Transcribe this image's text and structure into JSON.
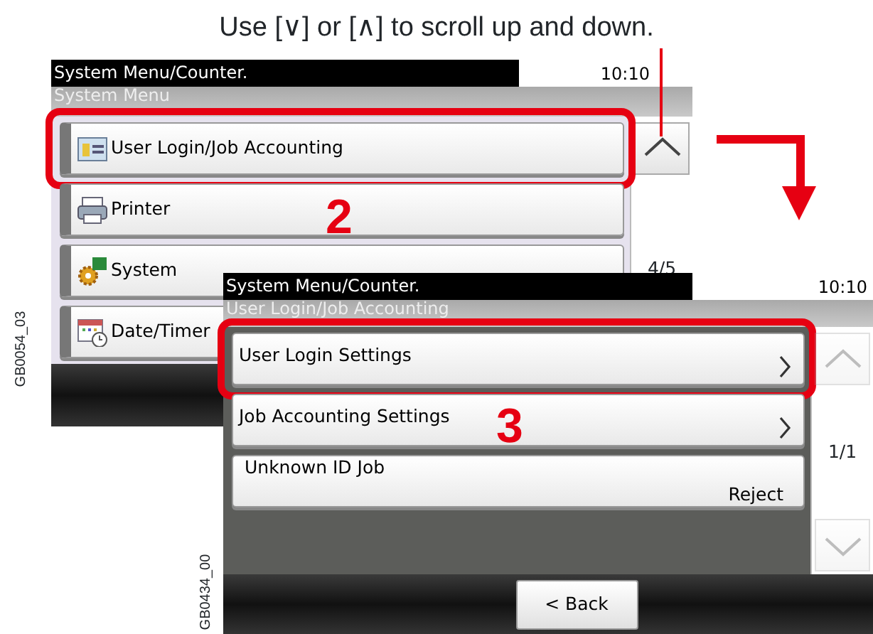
{
  "caption": "Use [∨] or [∧] to scroll up and down.",
  "screens": [
    {
      "title": "System Menu/Counter.",
      "time": "10:10",
      "subtitle": "System Menu",
      "page": "4/5",
      "scroll_up": {
        "disabled": false
      },
      "items": [
        {
          "kind": "menu",
          "label": "User Login/Job Accounting",
          "highlighted": true
        },
        {
          "kind": "menu",
          "label": "Printer",
          "highlighted": false
        },
        {
          "kind": "menu",
          "label": "System",
          "highlighted": false
        },
        {
          "kind": "menu",
          "label": "Date/Timer",
          "highlighted": false
        }
      ]
    },
    {
      "title": "System Menu/Counter.",
      "time": "10:10",
      "subtitle": "User Login/Job Accounting",
      "page": "1/1",
      "scroll_up": {
        "disabled": true
      },
      "scroll_down": {
        "disabled": true
      },
      "back": "< Back",
      "items": [
        {
          "kind": "nav",
          "label": "User Login Settings",
          "highlighted": true
        },
        {
          "kind": "nav",
          "label": "Job Accounting Settings",
          "highlighted": false
        },
        {
          "kind": "value",
          "label": "Unknown ID Job",
          "value": "Reject",
          "highlighted": false
        },
        {
          "kind": "empty",
          "highlighted": false
        }
      ]
    }
  ],
  "step_numbers": [
    "2",
    "3"
  ],
  "figure_codes": [
    "GB0054_03",
    "GB0434_00"
  ]
}
